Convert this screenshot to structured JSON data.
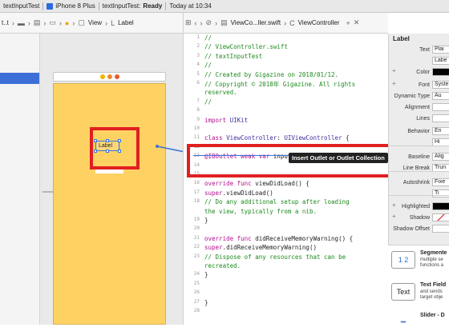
{
  "toolbar": {
    "scheme": "textInputTest",
    "device": "iPhone 8 Plus",
    "status_project": "textInputTest:",
    "status_state": "Ready",
    "status_time": "Today at 10:34"
  },
  "left_jumpbar": {
    "crumb1": "t..t",
    "crumb_view": "View",
    "crumb_label": "Label"
  },
  "editor_jumpbar": {
    "file": "ViewCo...ller.swift",
    "symbol": "ViewController"
  },
  "outline": {
    "selected_row": ""
  },
  "canvas": {
    "label_text": "Label"
  },
  "code": {
    "lines": [
      {
        "n": "1",
        "text": "//"
      },
      {
        "n": "2",
        "text": "//  ViewController.swift"
      },
      {
        "n": "3",
        "text": "//  textInputTest"
      },
      {
        "n": "4",
        "text": "//"
      },
      {
        "n": "5",
        "text": "//  Created by Gigazine on 2018/01/12."
      },
      {
        "n": "6",
        "text": "//  Copyright © 2018年 Gigazine. All rights"
      },
      {
        "n": "",
        "text": "    reserved."
      },
      {
        "n": "7",
        "text": "//"
      },
      {
        "n": "8",
        "text": ""
      },
      {
        "n": "9",
        "text": "import UIKit"
      },
      {
        "n": "10",
        "text": ""
      },
      {
        "n": "11",
        "text": "class ViewController: UIViewController {"
      },
      {
        "n": "12",
        "text": ""
      },
      {
        "n": "13",
        "text": "    @IBOutlet weak var inputField: UITextField!"
      },
      {
        "n": "14",
        "text": ""
      },
      {
        "n": "15",
        "text": ""
      },
      {
        "n": "16",
        "text": "    override func viewDidLoad() {"
      },
      {
        "n": "17",
        "text": "        super.viewDidLoad()"
      },
      {
        "n": "18",
        "text": "        // Do any additional setup after loading"
      },
      {
        "n": "",
        "text": "           the view, typically from a nib."
      },
      {
        "n": "19",
        "text": "    }"
      },
      {
        "n": "20",
        "text": ""
      },
      {
        "n": "21",
        "text": "    override func didReceiveMemoryWarning() {"
      },
      {
        "n": "22",
        "text": "        super.didReceiveMemoryWarning()"
      },
      {
        "n": "23",
        "text": "        // Dispose of any resources that can be"
      },
      {
        "n": "",
        "text": "           recreated."
      },
      {
        "n": "24",
        "text": "    }"
      },
      {
        "n": "25",
        "text": ""
      },
      {
        "n": "26",
        "text": ""
      },
      {
        "n": "27",
        "text": "}"
      },
      {
        "n": "28",
        "text": ""
      }
    ],
    "tooltip": "Insert Outlet or Outlet Collection"
  },
  "inspector": {
    "title": "Label",
    "rows": [
      {
        "label": "Text",
        "value": "Plai"
      },
      {
        "label": "",
        "value": "Labe"
      },
      {
        "label": "Color",
        "value": ""
      },
      {
        "label": "Font",
        "value": "Syste"
      },
      {
        "label": "Dynamic Type",
        "value": "Au"
      },
      {
        "label": "Alignment",
        "value": ""
      },
      {
        "label": "Lines",
        "value": ""
      },
      {
        "label": "Behavior",
        "value": "En"
      },
      {
        "label": "",
        "value": "Hi"
      },
      {
        "label": "Baseline",
        "value": "Alig"
      },
      {
        "label": "Line Break",
        "value": "Trun"
      },
      {
        "label": "Autoshrink",
        "value": "Fixe"
      },
      {
        "label": "",
        "value": "Ti"
      },
      {
        "label": "Highlighted",
        "value": ""
      },
      {
        "label": "Shadow",
        "value": ""
      },
      {
        "label": "Shadow Offset",
        "value": ""
      }
    ]
  },
  "library": {
    "items": [
      {
        "icon": "1 2",
        "name": "Segmente",
        "desc1": "multiple se",
        "desc2": "functions a"
      },
      {
        "icon": "Text",
        "name": "Text Field",
        "desc1": "and sends",
        "desc2": "target obje"
      },
      {
        "icon": "",
        "name": "Slider - D",
        "desc1": "",
        "desc2": ""
      }
    ]
  },
  "colors": {
    "highlight": "#e02020",
    "view_bg": "#fed163",
    "selection": "#3b72d9"
  }
}
